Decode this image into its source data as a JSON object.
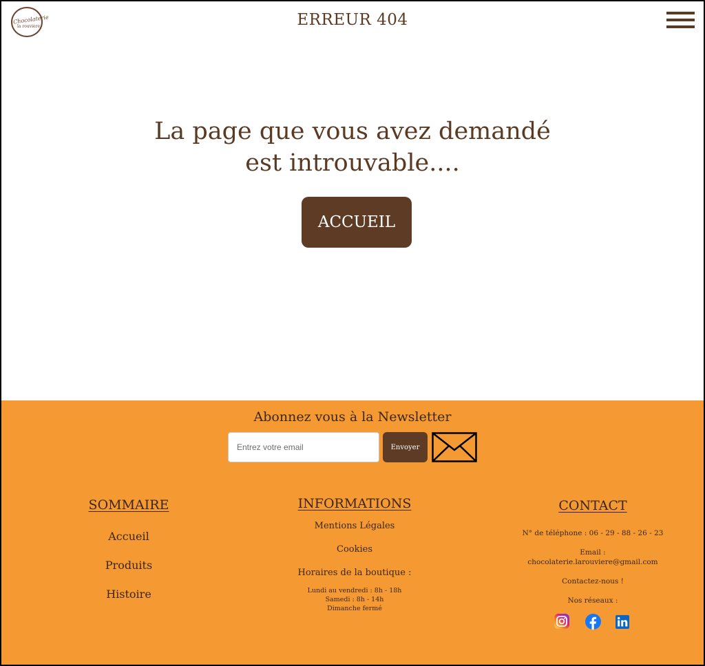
{
  "header": {
    "logo_line1": "Chocolaterie",
    "logo_line2": "la rouviere",
    "title": "ERREUR 404",
    "menu_icon": "hamburger-icon"
  },
  "main": {
    "message_line1": "La page que vous avez demandé",
    "message_line2": "est introuvable....",
    "button_label": "ACCUEIL"
  },
  "newsletter": {
    "title": "Abonnez vous à la Newsletter",
    "placeholder": "Entrez votre email",
    "button_label": "Envoyer",
    "icon": "envelope-icon"
  },
  "sommaire": {
    "title": "SOMMAIRE",
    "links": [
      "Accueil",
      "Produits",
      "Histoire"
    ]
  },
  "informations": {
    "title": "INFORMATIONS",
    "links": [
      "Mentions Légales",
      "Cookies"
    ],
    "horaires_title": "Horaires de la boutique :",
    "horaires": [
      "Lundi au vendredi : 8h - 18h",
      "Samedi : 8h - 14h",
      "Dimanche fermé"
    ]
  },
  "contact": {
    "title": "CONTACT",
    "phone": "N° de téléphone : 06 - 29 - 88 - 26 - 23",
    "email_label": "Email :",
    "email": "chocolaterie.larouviere@gmail.com",
    "contact_link": "Contactez-nous !",
    "socials_label": "Nos réseaux :",
    "socials": [
      "instagram-icon",
      "facebook-icon",
      "linkedin-icon"
    ]
  },
  "colors": {
    "brand_brown": "#5e3b24",
    "footer_orange": "#f59a32",
    "facebook_blue": "#1877f2",
    "linkedin_blue": "#0a66c2"
  }
}
